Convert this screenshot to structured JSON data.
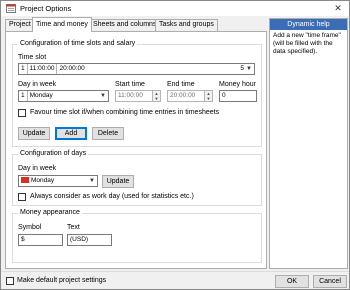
{
  "window": {
    "title": "Project Options",
    "close_glyph": "✕"
  },
  "tabs": [
    {
      "label": "Project",
      "active": false
    },
    {
      "label": "Time and money",
      "active": true
    },
    {
      "label": "Sheets and columns",
      "active": false
    },
    {
      "label": "Tasks and groups",
      "active": false
    }
  ],
  "slots": {
    "group_title": "Configuration of time slots and salary",
    "time_slot_label": "Time slot",
    "time_slot_value": {
      "index": "1",
      "start": "11:00:00",
      "end": "20:00:00",
      "count": "5"
    },
    "day_in_week_label": "Day in week",
    "day_in_week_value": {
      "index": "1",
      "day": "Monday"
    },
    "start_time_label": "Start time",
    "start_time_value": "11:00:00",
    "end_time_label": "End time",
    "end_time_value": "20:00:00",
    "money_hour_label": "Money hour",
    "money_hour_value": "0",
    "favour_label": "Favour time slot if/when combining time entries in timesheets",
    "update_label": "Update",
    "add_label": "Add",
    "delete_label": "Delete"
  },
  "days": {
    "group_title": "Configuration of days",
    "day_in_week_label": "Day in week",
    "day_value": "Monday",
    "update_label": "Update",
    "always_work_label": "Always consider as work day (used for statistics etc.)",
    "day_color": "#d93025"
  },
  "money": {
    "group_title": "Money appearance",
    "symbol_label": "Symbol",
    "symbol_value": "$",
    "text_label": "Text",
    "text_value": "(USD)"
  },
  "help": {
    "title": "Dynamic help",
    "text": "Add a new \"time frame\" (will be filled with the data specified)."
  },
  "footer": {
    "make_default_label": "Make default project settings",
    "ok_label": "OK",
    "cancel_label": "Cancel"
  },
  "colors": {
    "accent": "#0078d7",
    "help_header": "#3b6db6"
  }
}
